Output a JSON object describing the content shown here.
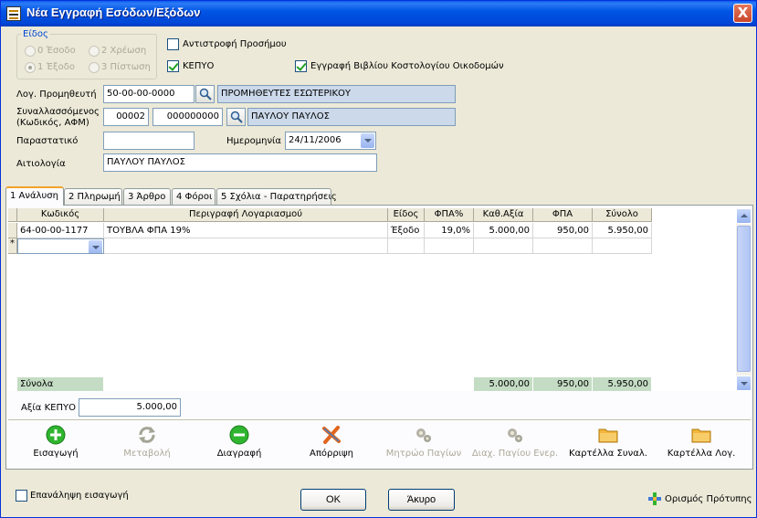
{
  "window": {
    "title": "Νέα Εγγραφή Εσόδων/Εξόδων",
    "close": "X"
  },
  "type_group": {
    "legend": "Είδος",
    "options": [
      "0 Έσοδο",
      "2 Χρέωση",
      "1 Έξοδο",
      "3 Πίστωση"
    ],
    "selected": "1 Έξοδο"
  },
  "checks": {
    "reverse_sign": {
      "label": "Αντιστροφή Προσήμου",
      "checked": false
    },
    "kepyo": {
      "label": "ΚΕΠΥΟ",
      "checked": true
    },
    "cost_book": {
      "label": "Εγγραφή Βιβλίου Κοστολογίου Οικοδομών",
      "checked": true
    }
  },
  "fields": {
    "supplier_label": "Λογ. Προμηθευτή",
    "supplier_code": "50-00-00-0000",
    "supplier_name": "ΠΡΟΜΗΘΕΥΤΕΣ ΕΣΩΤΕΡΙΚΟΥ",
    "party_label_1": "Συναλλασσόμενος",
    "party_label_2": "(Κωδικός, ΑΦΜ)",
    "party_code": "00002",
    "party_afm": "000000000",
    "party_name": "ΠΑΥΛΟΥ ΠΑΥΛΟΣ",
    "document_label": "Παραστατικό",
    "document_value": "",
    "date_label": "Ημερομηνία",
    "date_value": "24/11/2006",
    "reason_label": "Αιτιολογία",
    "reason_value": "ΠΑΥΛΟΥ ΠΑΥΛΟΣ"
  },
  "tabs": [
    "1 Ανάλυση",
    "2 Πληρωμή",
    "3 Άρθρο",
    "4 Φόροι",
    "5 Σχόλια - Παρατηρήσεις"
  ],
  "grid": {
    "columns": [
      "Κωδικός",
      "Περιγραφή Λογαριασμού",
      "Είδος",
      "ΦΠΑ%",
      "Καθ.Αξία",
      "ΦΠΑ",
      "Σύνολο"
    ],
    "rows": [
      {
        "code": "64-00-00-1177",
        "description": "ΤΟΥΒΛΑ ΦΠΑ 19%",
        "type": "Έξοδο",
        "vat_pct": "19,0%",
        "net": "5.000,00",
        "vat": "950,00",
        "total": "5.950,00"
      }
    ],
    "new_row_marker": "*",
    "totals_label": "Σύνολα",
    "totals": {
      "net": "5.000,00",
      "vat": "950,00",
      "total": "5.950,00"
    }
  },
  "kepyo_value": {
    "label": "Αξία ΚΕΠΥΟ",
    "value": "5.000,00"
  },
  "toolbar": {
    "insert": "Εισαγωγή",
    "modify": "Μεταβολή",
    "delete": "Διαγραφή",
    "discard": "Απόρριψη",
    "assets_register": "Μητρώο Παγίων",
    "asset_manage": "Διαχ. Παγίου Ενερ.",
    "party_card": "Καρτέλλα Συναλ.",
    "account_card": "Καρτέλλα Λογ."
  },
  "footer": {
    "repeat_entry": "Επανάληψη εισαγωγή",
    "ok": "OK",
    "cancel": "Άκυρο",
    "define_template": "Ορισμός Πρότυπης"
  },
  "colors": {
    "titlebar": "#0055e5",
    "readonly_field": "#cbd9ea",
    "totals_bg": "#c4dcc4",
    "insert_icon": "#2fb52f",
    "delete_icon": "#2fb52f",
    "discard_icon": "#e0651c",
    "folder_icon": "#f2b63a"
  }
}
